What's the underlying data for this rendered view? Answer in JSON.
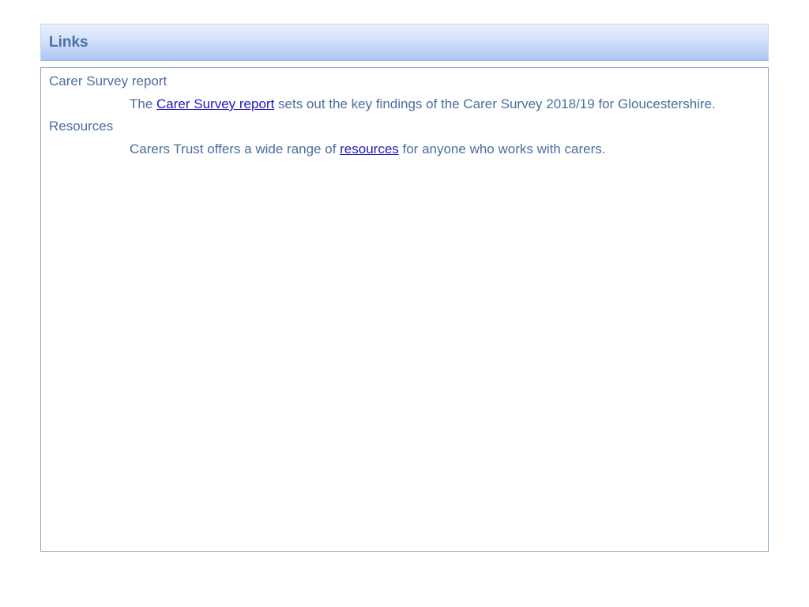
{
  "header": {
    "title": "Links"
  },
  "entries": [
    {
      "title": "Carer Survey report",
      "desc_prefix": "The ",
      "link_text": "Carer Survey report",
      "desc_suffix": " sets out the key findings of the Carer Survey 2018/19 for Gloucestershire."
    },
    {
      "title": "Resources",
      "desc_prefix": "Carers Trust offers a wide range of ",
      "link_text": "resources",
      "desc_suffix": " for anyone who works with carers."
    }
  ],
  "colors": {
    "header_gradient_top": "#e9f0fd",
    "header_gradient_bottom": "#abc6f2",
    "header_text": "#4a6fa0",
    "body_text": "#4a6e9e",
    "link": "#1c1cb8",
    "box_border": "#8aa6c8"
  }
}
